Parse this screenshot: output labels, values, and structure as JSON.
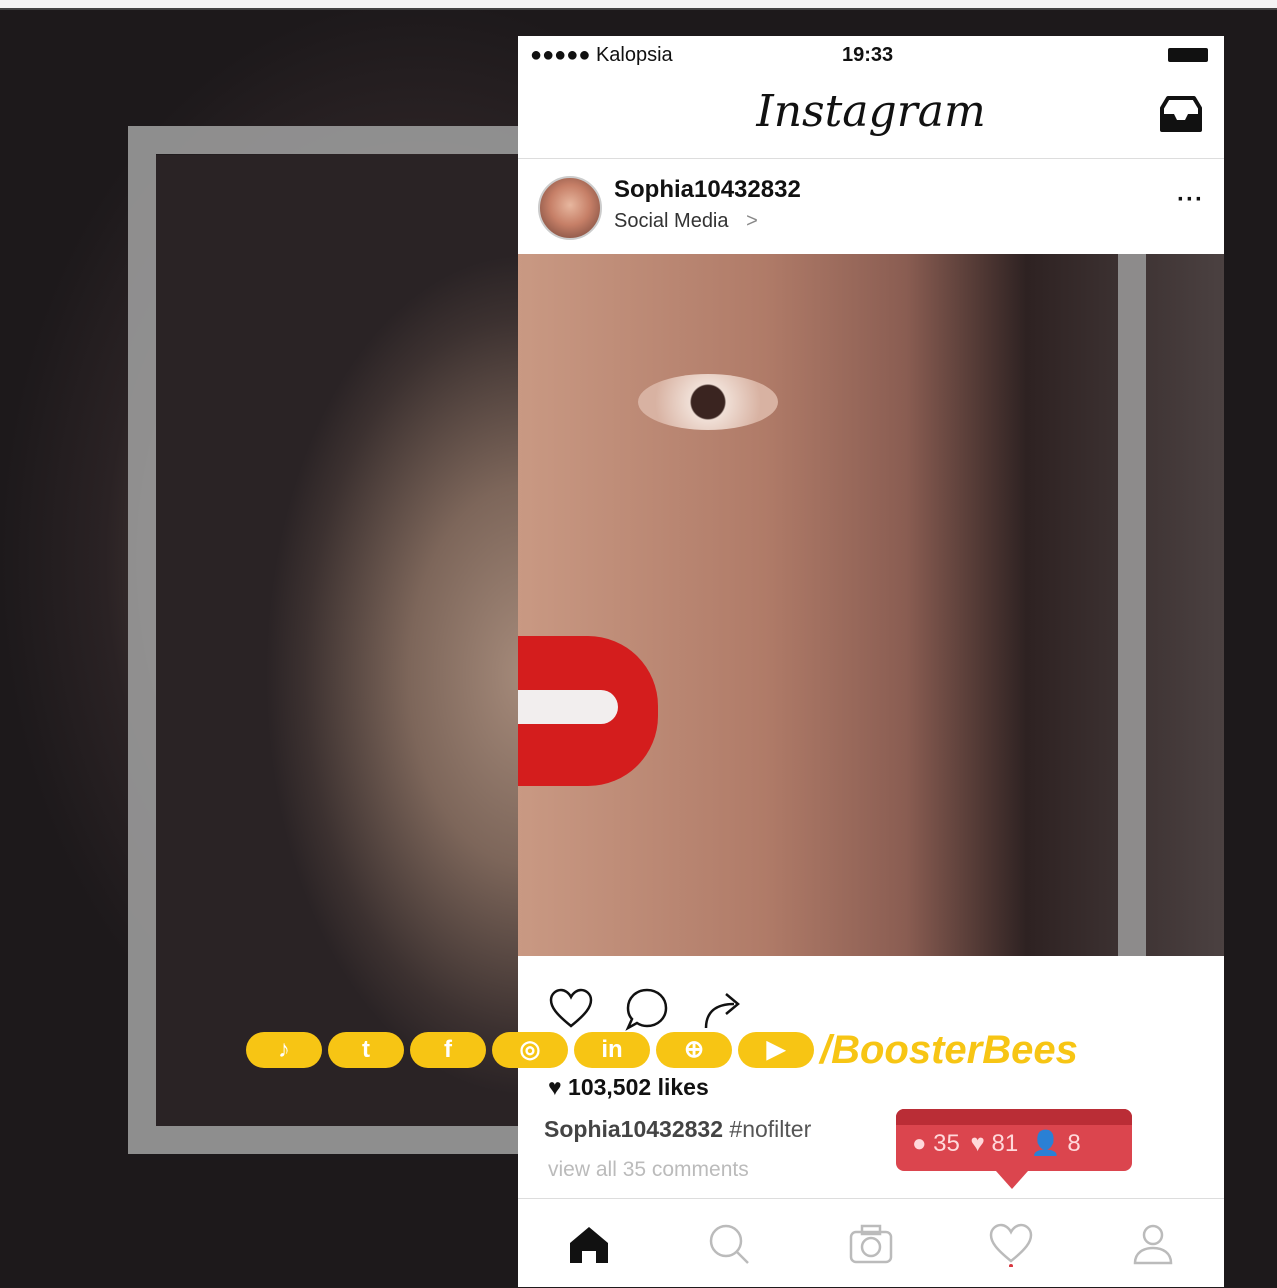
{
  "status_bar": {
    "carrier": "●●●●● Kalopsia",
    "time": "19:33"
  },
  "header": {
    "logo": "Instagram"
  },
  "post": {
    "username": "Sophia10432832",
    "location": "Social Media",
    "location_chevron": ">",
    "more": "···",
    "likes": "103,502 likes",
    "caption_user": "Sophia10432832",
    "caption_text": "#nofilter",
    "comments_link": "view all 35 comments"
  },
  "notification": {
    "comments": "35",
    "likes": "81",
    "followers": "8"
  },
  "social": {
    "icons": [
      "tiktok-icon",
      "twitter-icon",
      "facebook-icon",
      "instagram-icon",
      "linkedin-icon",
      "globe-icon",
      "youtube-icon"
    ],
    "labels": {
      "tiktok": "♪",
      "twitter": "t",
      "facebook": "f",
      "instagram": "◎",
      "linkedin": "in",
      "globe": "⊕",
      "youtube": "▶"
    },
    "handle": "/BoosterBees"
  },
  "colors": {
    "accent": "#f7c514",
    "notification": "#d8363f",
    "lips": "#d41d1d"
  }
}
